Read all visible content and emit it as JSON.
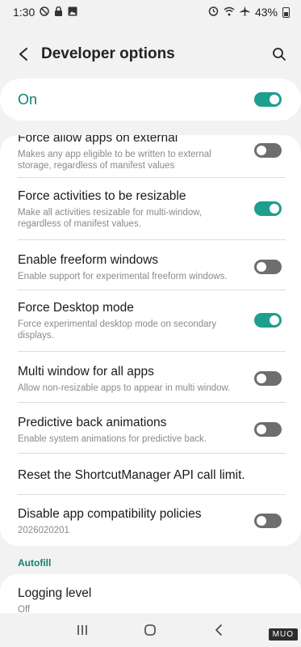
{
  "status_bar": {
    "time": "1:30",
    "battery": "43%",
    "icons": [
      "silent-icon",
      "lock-icon",
      "gallery-icon",
      "alarm-icon",
      "wifi-icon",
      "airplane-icon",
      "battery-icon"
    ]
  },
  "app_bar": {
    "title": "Developer options",
    "back_icon": "back-arrow-icon",
    "search_icon": "search-icon"
  },
  "master_switch": {
    "label": "On",
    "state": true
  },
  "settings": [
    {
      "title": "Force allow apps on external",
      "subtitle": "Makes any app eligible to be written to external storage, regardless of manifest values",
      "toggle": false
    },
    {
      "title": "Force activities to be resizable",
      "subtitle": "Make all activities resizable for multi-window, regardless of manifest values.",
      "toggle": true
    },
    {
      "title": "Enable freeform windows",
      "subtitle": "Enable support for experimental freeform windows.",
      "toggle": false
    },
    {
      "title": "Force Desktop mode",
      "subtitle": "Force experimental desktop mode on secondary displays.",
      "toggle": true
    },
    {
      "title": "Multi window for all apps",
      "subtitle": "Allow non-resizable apps to appear in multi window.",
      "toggle": false
    },
    {
      "title": "Predictive back animations",
      "subtitle": "Enable system animations for predictive back.",
      "toggle": false
    },
    {
      "title": "Reset the ShortcutManager API call limit.",
      "subtitle": "",
      "toggle": null
    },
    {
      "title": "Disable app compatibility policies",
      "subtitle": "2026020201",
      "toggle": false
    }
  ],
  "section_autofill": {
    "header": "Autofill",
    "item_title": "Logging level",
    "item_value": "Off"
  },
  "nav_bar": {
    "icons": [
      "recents-icon",
      "home-icon",
      "back-icon"
    ]
  },
  "watermark": "MUO",
  "colors": {
    "accent": "#1d9e8f",
    "accent_text": "#0f7f73",
    "toggle_off": "#6e6e6e",
    "background": "#f2f2f2"
  }
}
